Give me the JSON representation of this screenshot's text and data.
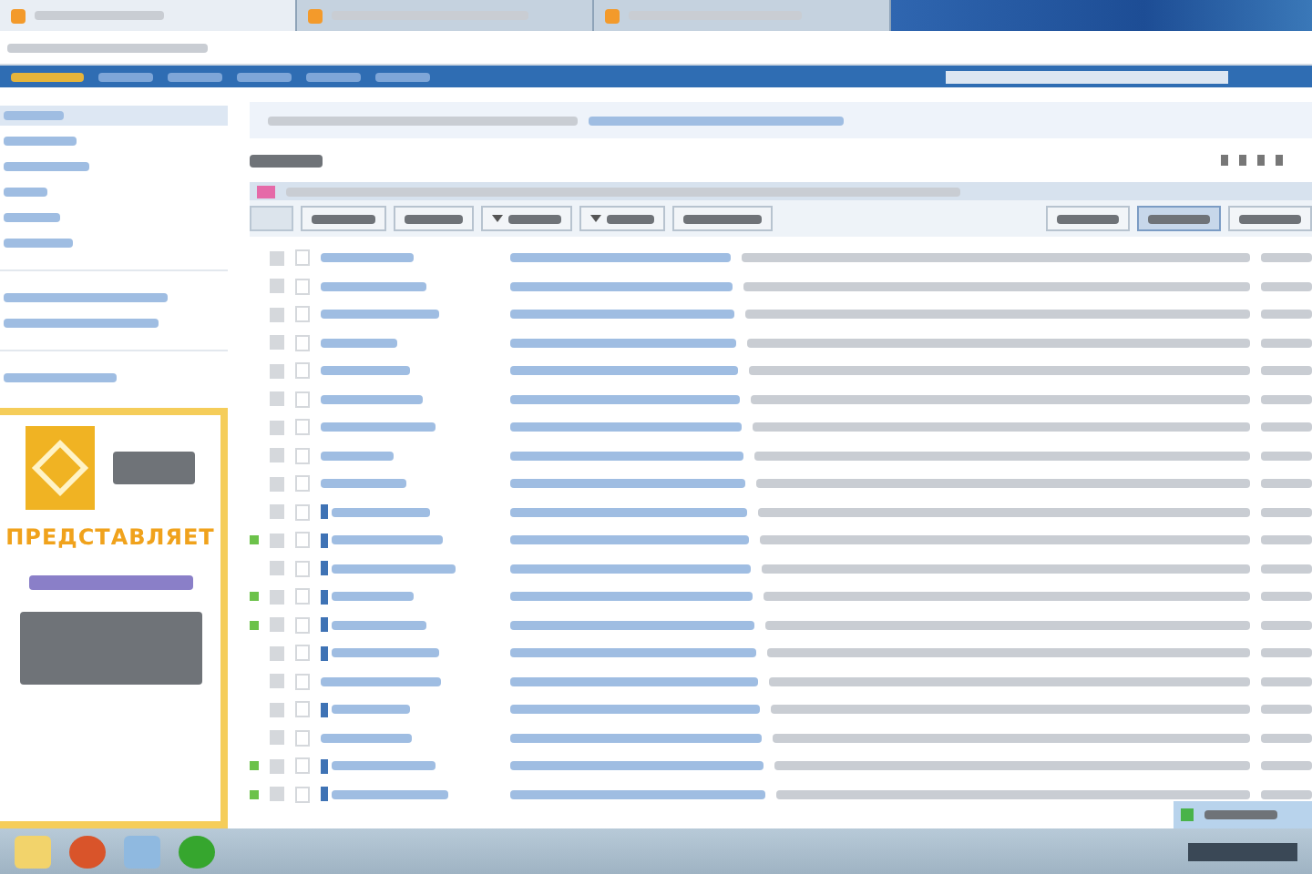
{
  "browser": {
    "tabs": [
      {
        "selected": true
      },
      {
        "selected": false
      },
      {
        "selected": false
      }
    ]
  },
  "sidebar": {
    "items": [
      {
        "selected": true
      },
      {
        "selected": false
      },
      {
        "selected": false
      },
      {
        "selected": false
      },
      {
        "selected": false
      },
      {
        "selected": false
      }
    ]
  },
  "ad": {
    "headline": "ПРЕДСТАВЛЯЕТ"
  },
  "toolbar": {
    "buttons": [
      {
        "kind": "plain"
      },
      {
        "kind": "plain"
      },
      {
        "kind": "menu"
      },
      {
        "kind": "menu"
      },
      {
        "kind": "plain"
      }
    ],
    "views": [
      {
        "selected": false
      },
      {
        "selected": true
      },
      {
        "selected": false
      }
    ]
  },
  "rows": [
    {
      "marked": false,
      "icon": false,
      "checked": false
    },
    {
      "marked": false,
      "icon": false,
      "checked": false
    },
    {
      "marked": false,
      "icon": false,
      "checked": false
    },
    {
      "marked": false,
      "icon": false,
      "checked": false
    },
    {
      "marked": false,
      "icon": false,
      "checked": false
    },
    {
      "marked": false,
      "icon": false,
      "checked": false
    },
    {
      "marked": false,
      "icon": false,
      "checked": false
    },
    {
      "marked": false,
      "icon": false,
      "checked": false
    },
    {
      "marked": false,
      "icon": false,
      "checked": false
    },
    {
      "marked": false,
      "icon": true,
      "checked": false
    },
    {
      "marked": true,
      "icon": true,
      "checked": false
    },
    {
      "marked": false,
      "icon": true,
      "checked": false
    },
    {
      "marked": true,
      "icon": true,
      "checked": false
    },
    {
      "marked": true,
      "icon": true,
      "checked": false
    },
    {
      "marked": false,
      "icon": true,
      "checked": false
    },
    {
      "marked": false,
      "icon": false,
      "checked": false
    },
    {
      "marked": false,
      "icon": true,
      "checked": false
    },
    {
      "marked": false,
      "icon": false,
      "checked": false
    },
    {
      "marked": true,
      "icon": true,
      "checked": false
    },
    {
      "marked": true,
      "icon": true,
      "checked": false
    }
  ]
}
